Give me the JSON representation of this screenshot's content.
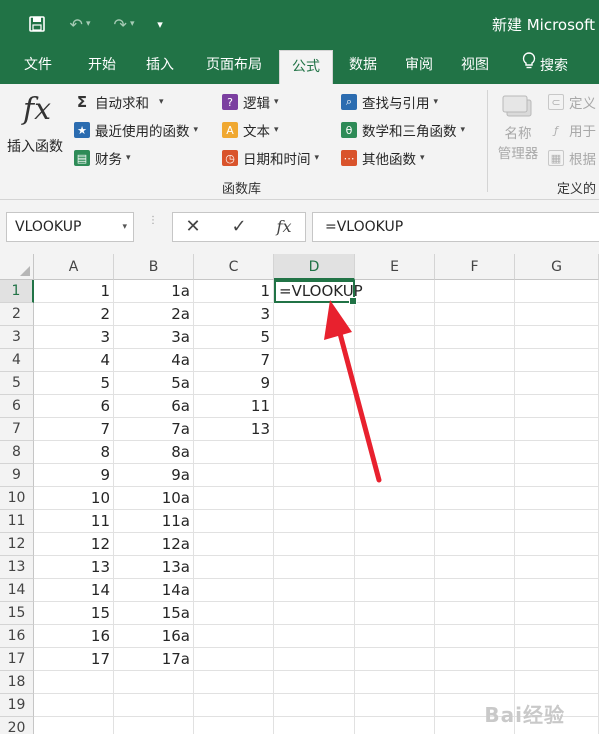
{
  "titlebar": {
    "title": "新建 Microsoft",
    "save_icon": "save-icon",
    "undo_icon": "undo-icon",
    "redo_icon": "redo-icon"
  },
  "tabs": [
    "文件",
    "开始",
    "插入",
    "页面布局",
    "公式",
    "数据",
    "审阅",
    "视图",
    "搜索"
  ],
  "active_tab": "公式",
  "ribbon": {
    "insert_function": {
      "label_top": "插入函数",
      "icon": "fx"
    },
    "library": {
      "autosum": "自动求和",
      "recent": "最近使用的函数",
      "financial": "财务",
      "logical": "逻辑",
      "text": "文本",
      "datetime": "日期和时间",
      "lookup": "查找与引用",
      "math": "数学和三角函数",
      "more": "其他函数",
      "group_label": "函数库"
    },
    "defined_names": {
      "name_manager_1": "名称",
      "name_manager_2": "管理器",
      "define": "定义",
      "use_in": "用于",
      "create": "根据",
      "group_label": "定义的"
    }
  },
  "formula_bar": {
    "name_box": "VLOOKUP",
    "cancel_symbol": "✕",
    "enter_symbol": "✓",
    "fx_symbol": "fx",
    "formula": "=VLOOKUP"
  },
  "columns": [
    "A",
    "B",
    "C",
    "D",
    "E",
    "F",
    "G"
  ],
  "selected_column": "D",
  "rows": [
    "1",
    "2",
    "3",
    "4",
    "5",
    "6",
    "7",
    "8",
    "9",
    "10",
    "11",
    "12",
    "13",
    "14",
    "15",
    "16",
    "17",
    "18",
    "19",
    "20"
  ],
  "selected_row": "1",
  "col_a": [
    "1",
    "2",
    "3",
    "4",
    "5",
    "6",
    "7",
    "8",
    "9",
    "10",
    "11",
    "12",
    "13",
    "14",
    "15",
    "16",
    "17"
  ],
  "col_b": [
    "1a",
    "2a",
    "3a",
    "4a",
    "5a",
    "6a",
    "7a",
    "8a",
    "9a",
    "10a",
    "11a",
    "12a",
    "13a",
    "14a",
    "15a",
    "16a",
    "17a"
  ],
  "col_c": [
    "1",
    "3",
    "5",
    "7",
    "9",
    "11",
    "13"
  ],
  "active_cell_text": "=VLOOKUP",
  "colors": {
    "excel_green": "#217346",
    "arrow_red": "#e8212e"
  },
  "watermark": "Bai经验"
}
